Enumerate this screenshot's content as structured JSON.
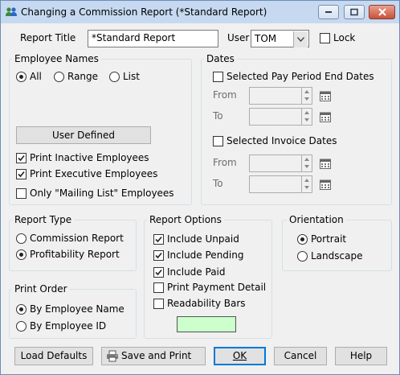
{
  "window": {
    "title": "Changing a Commission Report  (*Standard Report)"
  },
  "header": {
    "report_title_label": "Report Title",
    "report_title_value": "*Standard Report",
    "user_label": "User",
    "user_value": "TOM",
    "lock_label": "Lock",
    "lock_checked": false
  },
  "employee_names": {
    "title": "Employee Names",
    "all_label": "All",
    "range_label": "Range",
    "list_label": "List",
    "selected": "All",
    "user_defined_label": "User Defined",
    "print_inactive_label": "Print Inactive Employees",
    "print_inactive_checked": true,
    "print_executive_label": "Print Executive Employees",
    "print_executive_checked": true,
    "mailing_list_label": "Only \"Mailing List\" Employees",
    "mailing_list_checked": false
  },
  "dates": {
    "title": "Dates",
    "pay_period_label": "Selected Pay Period End Dates",
    "pay_period_checked": false,
    "invoice_label": "Selected Invoice Dates",
    "invoice_checked": false,
    "from_label": "From",
    "to_label": "To"
  },
  "report_type": {
    "title": "Report Type",
    "commission_label": "Commission Report",
    "profitability_label": "Profitability Report",
    "selected": "Profitability Report"
  },
  "report_options": {
    "title": "Report Options",
    "include_unpaid_label": "Include Unpaid",
    "include_unpaid_checked": true,
    "include_pending_label": "Include Pending",
    "include_pending_checked": true,
    "include_paid_label": "Include Paid",
    "include_paid_checked": true,
    "print_payment_detail_label": "Print Payment Detail",
    "print_payment_detail_checked": false,
    "readability_bars_label": "Readability Bars",
    "readability_bars_checked": false,
    "bar_color": "#ccffcc"
  },
  "orientation": {
    "title": "Orientation",
    "portrait_label": "Portrait",
    "landscape_label": "Landscape",
    "selected": "Portrait"
  },
  "print_order": {
    "title": "Print Order",
    "by_name_label": "By Employee Name",
    "by_id_label": "By Employee ID",
    "selected": "By Employee Name"
  },
  "footer": {
    "load_defaults_label": "Load Defaults",
    "save_print_label": "Save and Print",
    "ok_label": "OK",
    "cancel_label": "Cancel",
    "help_label": "Help"
  },
  "icons": {
    "app": "users-icon",
    "printer": "printer-icon",
    "calendar": "calendar-icon"
  }
}
